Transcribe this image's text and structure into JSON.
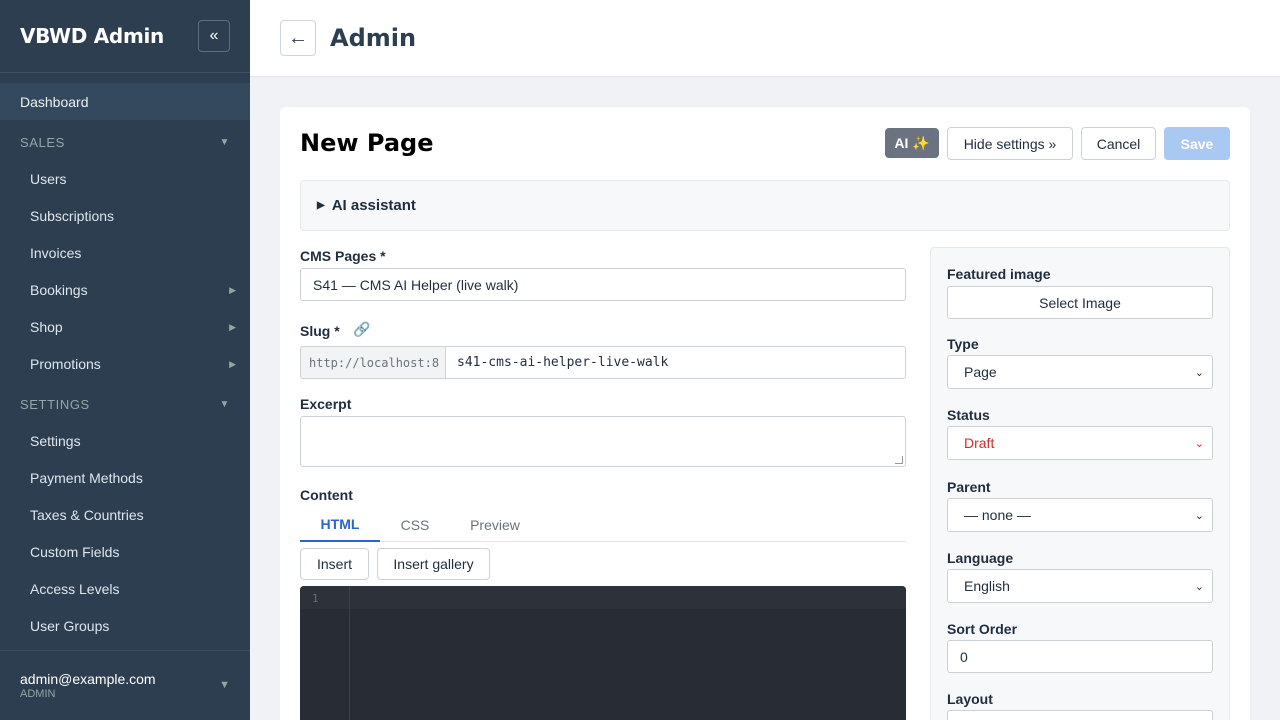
{
  "sidebar": {
    "title": "VBWD Admin",
    "collapse_icon": "«",
    "dashboard": "Dashboard",
    "sales_label": "SALES",
    "sales_items": [
      "Users",
      "Subscriptions",
      "Invoices",
      "Bookings",
      "Shop",
      "Promotions"
    ],
    "settings_label": "SETTINGS",
    "settings_items": [
      "Settings",
      "Payment Methods",
      "Taxes & Countries",
      "Custom Fields",
      "Access Levels",
      "User Groups"
    ],
    "user_email": "admin@example.com",
    "user_role": "ADMIN"
  },
  "topbar": {
    "back_icon": "←",
    "title": "Admin"
  },
  "page": {
    "title": "New Page",
    "ai_button": "AI ✨",
    "hide_settings_button": "Hide settings »",
    "cancel_button": "Cancel",
    "save_button": "Save",
    "ai_assistant_label": "AI assistant"
  },
  "form": {
    "cms_pages_label": "CMS Pages *",
    "cms_pages_value": "S41 — CMS AI Helper (live walk)",
    "slug_label": "Slug *",
    "slug_prefix": "http://localhost:8",
    "slug_value": "s41-cms-ai-helper-live-walk",
    "excerpt_label": "Excerpt",
    "excerpt_value": "",
    "content_label": "Content",
    "tabs": [
      "HTML",
      "CSS",
      "Preview"
    ],
    "active_tab": "HTML",
    "insert_button": "Insert",
    "insert_gallery_button": "Insert gallery",
    "editor_line_number": "1"
  },
  "settings_panel": {
    "featured_image_label": "Featured image",
    "select_image_button": "Select Image",
    "type_label": "Type",
    "type_value": "Page",
    "status_label": "Status",
    "status_value": "Draft",
    "parent_label": "Parent",
    "parent_value": "— none —",
    "language_label": "Language",
    "language_value": "English",
    "sort_order_label": "Sort Order",
    "sort_order_value": "0",
    "layout_label": "Layout"
  },
  "colors": {
    "sidebar_bg": "#2c3e50",
    "accent": "#2a63d4",
    "save_disabled": "#a9c8f2",
    "draft_status": "#d12a2a"
  }
}
